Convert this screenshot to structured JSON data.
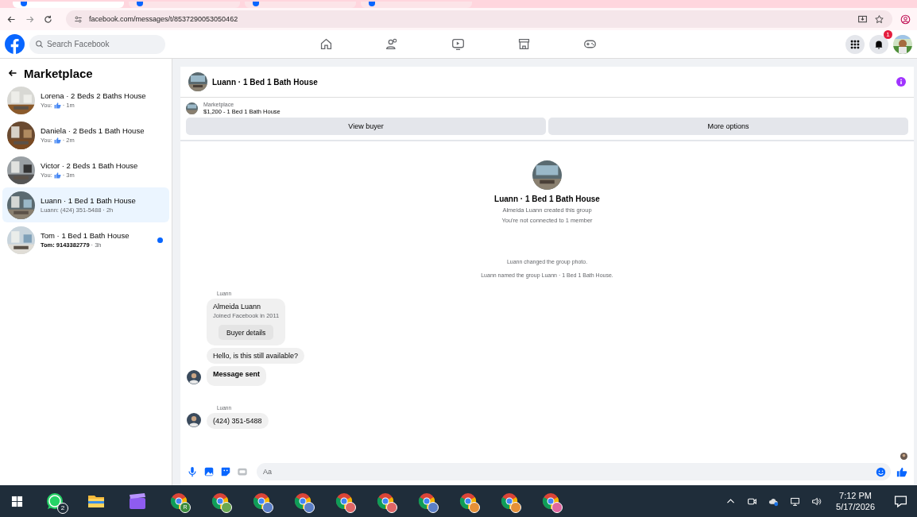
{
  "browser": {
    "url": "facebook.com/messages/t/8537290053050462",
    "tabs": [
      {
        "selected": true
      },
      {
        "selected": false
      },
      {
        "selected": false
      },
      {
        "selected": false
      }
    ]
  },
  "header": {
    "search": {
      "placeholder": "Search Facebook"
    },
    "notification_count": "1"
  },
  "sidebar": {
    "title": "Marketplace",
    "items": [
      {
        "kind": "like",
        "title": "Lorena · 2 Beds 2 Baths House",
        "preview": "You:",
        "time": "· 1m",
        "selected": false,
        "unread": false
      },
      {
        "kind": "like",
        "title": "Daniela · 2 Beds 1 Bath House",
        "preview": "You:",
        "time": "· 2m",
        "selected": false,
        "unread": false
      },
      {
        "kind": "like",
        "title": "Victor · 2 Beds 1 Bath House",
        "preview": "You:",
        "time": "· 3m",
        "selected": false,
        "unread": false
      },
      {
        "kind": "text",
        "title": "Luann · 1 Bed 1 Bath House",
        "preview": "Luann: (424) 351-5488",
        "time": "· 2h",
        "selected": true,
        "unread": false
      },
      {
        "kind": "text",
        "title": "Tom · 1 Bed 1 Bath House",
        "preview": "Tom: 9143382779",
        "time": "· 3h",
        "selected": false,
        "unread": true
      }
    ]
  },
  "chat": {
    "title": "Luann · 1 Bed 1 Bath House",
    "listing": {
      "label": "Marketplace",
      "text": "$1,200 - 1 Bed 1 Bath House"
    },
    "buttons": [
      "View buyer",
      "More options"
    ],
    "intro": {
      "title": "Luann · 1 Bed 1 Bath House",
      "lines": [
        "Almeida Luann created this group",
        "You're not connected to 1 member"
      ]
    },
    "events": [
      "Luann changed the group photo.",
      "Luann named the group Luann · 1 Bed 1 Bath House."
    ],
    "messages": [
      {
        "kind": "sender",
        "text": "Luann"
      },
      {
        "kind": "card",
        "title": "Almeida Luann",
        "subtitle": "Joined Facebook in 2011",
        "button": "Buyer details"
      },
      {
        "kind": "bubble",
        "text": "Hello, is this still available?",
        "avatar": false,
        "bold": false
      },
      {
        "kind": "bubble",
        "text": "Message sent",
        "avatar": true,
        "bold": true
      },
      {
        "kind": "gap"
      },
      {
        "kind": "sender",
        "text": "Luann"
      },
      {
        "kind": "bubble",
        "text": "(424) 351-5488",
        "avatar": true,
        "bold": false
      }
    ],
    "composer": {
      "placeholder": "Aa"
    }
  },
  "taskbar": {
    "apps": [
      {
        "kind": "whatsapp",
        "badge": "2"
      },
      {
        "kind": "folder"
      },
      {
        "kind": "clapper"
      },
      {
        "kind": "chrome",
        "color": "#3c8c3c",
        "badge": "R"
      },
      {
        "kind": "chrome",
        "color": "#6aa84f"
      },
      {
        "kind": "chrome",
        "color": "#5b7fc7"
      },
      {
        "kind": "chrome",
        "color": "#5b7fc7"
      },
      {
        "kind": "chrome",
        "color": "#e06666"
      },
      {
        "kind": "chrome",
        "color": "#e06666"
      },
      {
        "kind": "chrome",
        "color": "#5b7fc7"
      },
      {
        "kind": "chrome",
        "color": "#e69138"
      },
      {
        "kind": "chrome",
        "color": "#e69138"
      },
      {
        "kind": "chrome",
        "color": "#e0669e"
      }
    ],
    "time": "7:12 PM",
    "date": "5/17/2026"
  }
}
